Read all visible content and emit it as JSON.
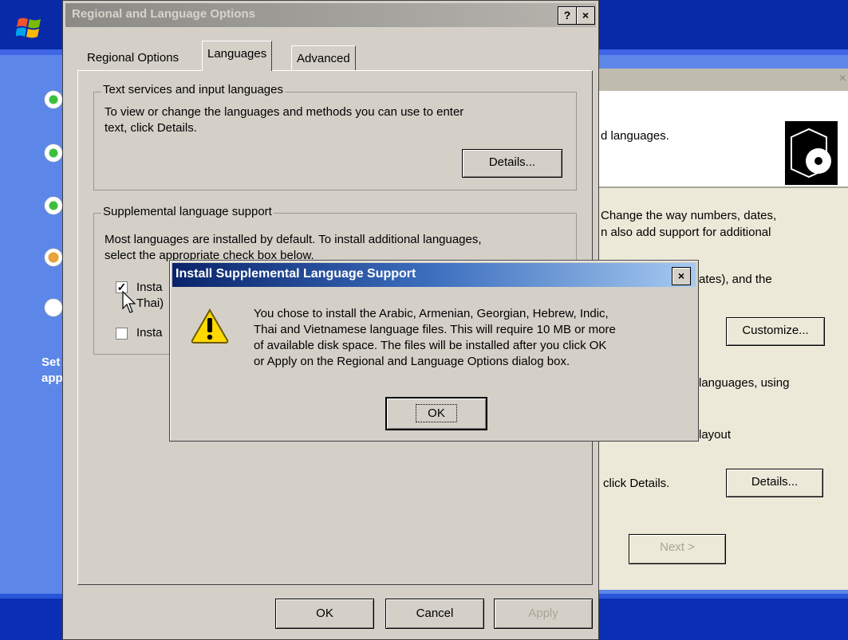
{
  "setup": {
    "side_text_1": "Set",
    "side_text_2": "app"
  },
  "wizard": {
    "close_glyph": "×",
    "header_text": "d languages.",
    "line1": "Change the way numbers, dates,",
    "line2": "n also add support for additional",
    "line3": "ates), and the",
    "customize_label": "Customize...",
    "line4": "languages, using",
    "line5": "layout",
    "line6": "click Details.",
    "details_label": "Details...",
    "next_label": "Next >"
  },
  "rlo": {
    "title": "Regional and Language Options",
    "help_glyph": "?",
    "close_glyph": "×",
    "tabs": [
      {
        "label": "Regional Options"
      },
      {
        "label": "Languages"
      },
      {
        "label": "Advanced"
      }
    ],
    "text_services": {
      "group_label": "Text services and input languages",
      "description_1": "To view or change the languages and methods you can use to enter",
      "description_2": "text, click Details.",
      "details_label": "Details..."
    },
    "supplemental": {
      "group_label": "Supplemental language support",
      "description_1": "Most languages are installed by default. To install additional languages,",
      "description_2": "select the appropriate check box below.",
      "checkbox1_label": "Insta",
      "checkbox1_label_2": "Thai)",
      "checkbox2_label": "Insta"
    },
    "buttons": {
      "ok": "OK",
      "cancel": "Cancel",
      "apply": "Apply"
    }
  },
  "supplemental_dialog": {
    "title": "Install Supplemental Language Support",
    "close_glyph": "×",
    "message_lines": [
      "You chose to install the Arabic, Armenian, Georgian, Hebrew, Indic,",
      "Thai and Vietnamese language files. This will require 10 MB or more",
      "of available disk space. The files will be installed after you click OK",
      "or Apply on the Regional and Language Options dialog box."
    ],
    "ok_label": "OK"
  },
  "colors": {
    "setup_blue": "#5c86e8",
    "title_active": "#0a246a",
    "title_inactive": "#8b8a86",
    "dialog_face": "#d4d0c8"
  }
}
